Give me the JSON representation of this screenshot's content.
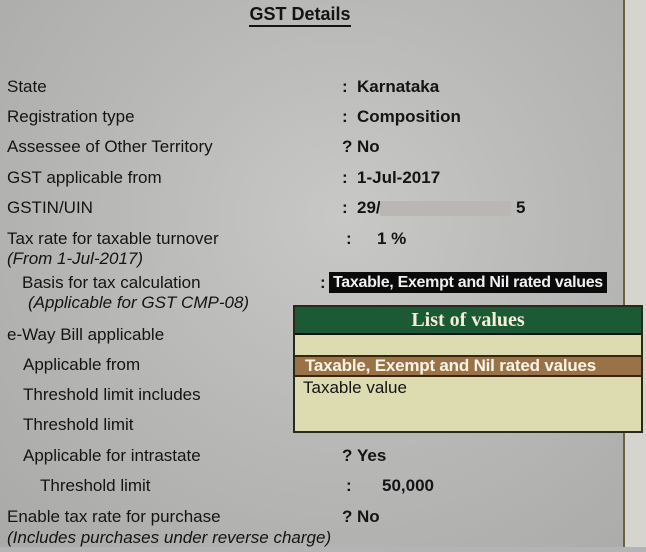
{
  "title": "GST Details",
  "fields": {
    "state": {
      "label": "State",
      "sep": ":",
      "value": "Karnataka"
    },
    "registration_type": {
      "label": "Registration type",
      "sep": ":",
      "value": "Composition"
    },
    "assessee_other_territory": {
      "label": "Assessee of Other Territory",
      "sep": "?",
      "value": "No"
    },
    "gst_applicable_from": {
      "label": "GST applicable from",
      "sep": ":",
      "value": "1-Jul-2017"
    },
    "gstin": {
      "label": "GSTIN/UIN",
      "sep": ":",
      "value_prefix": "29/",
      "value_suffix": "5"
    },
    "tax_rate": {
      "label": "Tax rate for taxable turnover",
      "sublabel": "(From 1-Jul-2017)",
      "sep": ":",
      "value": "1 %"
    },
    "basis_tax_calc": {
      "label": "Basis for tax calculation",
      "sublabel": "(Applicable for GST CMP-08)",
      "sep": ":",
      "value": "Taxable, Exempt and Nil rated values"
    },
    "eway_bill": {
      "label": "e-Way Bill applicable"
    },
    "applicable_from": {
      "label": "Applicable from"
    },
    "threshold_includes": {
      "label": "Threshold limit includes"
    },
    "threshold_limit": {
      "label": "Threshold limit"
    },
    "applicable_intrastate": {
      "label": "Applicable for intrastate",
      "sep": "?",
      "value": "Yes"
    },
    "intrastate_threshold": {
      "label": "Threshold limit",
      "sep": ":",
      "value": "50,000"
    },
    "enable_tax_purchase": {
      "label": "Enable tax rate for purchase",
      "sublabel": "(Includes purchases under reverse charge)",
      "sep": "?",
      "value": "No"
    }
  },
  "list_of_values": {
    "title": "List of values",
    "items": [
      {
        "label": "Taxable, Exempt and Nil rated values",
        "selected": true
      },
      {
        "label": "Taxable value",
        "selected": false
      }
    ]
  }
}
